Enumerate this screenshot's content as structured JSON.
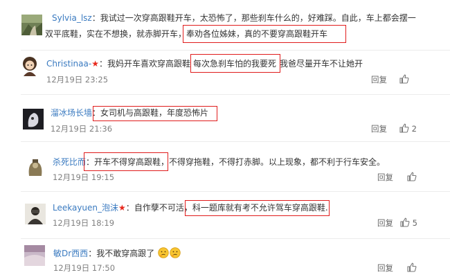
{
  "comments": [
    {
      "user": "Sylvia_lsz",
      "separator": "：",
      "line1": "我试过一次穿高跟鞋开车，太恐怖了，那些刹车什么的，好难踩。自此，车上都会摆一",
      "line2_a": "双平底鞋，实在不想换，就赤脚开车",
      "line2_b": "，奉劝各位姊妹，真的不要穿高跟鞋开车"
    },
    {
      "user": "Christinaa-",
      "separator": "：",
      "text_a": "我妈开车喜欢穿高跟鞋",
      "text_b": "每次急刹车怕的我要死",
      "text_c": "我爸尽量开车不让她开",
      "time": "12月19日 23:25",
      "reply": "回复"
    },
    {
      "user": "溜冰场长墙",
      "separator": "：",
      "text": "女司机与高跟鞋，年度恐怖片",
      "time": "12月19日 21:36",
      "reply": "回复",
      "likes": "2"
    },
    {
      "user": "杀死比而",
      "separator": "：",
      "text_a": "开车不得穿高跟鞋",
      "text_b": "，不得穿拖鞋，不得打赤脚。以上现象，都不利于行车安全。",
      "time": "12月19日 19:15",
      "reply": "回复"
    },
    {
      "user": "Leekayuen_泡沫",
      "separator": "：",
      "text_a": "自作孽不可活",
      "text_b": "，科一题库就有考不允许驾车穿高跟鞋.",
      "time": "12月19日 18:19",
      "reply": "回复",
      "likes": "5"
    },
    {
      "user": "敏Dr西西",
      "separator": "：",
      "text": "我不敢穿高跟了",
      "time": "12月19日 17:50",
      "reply": "回复"
    }
  ],
  "colors": {
    "username": "#3a7ac0",
    "highlight": "#e01b1b",
    "star": "#e8281c",
    "time": "#808080"
  }
}
